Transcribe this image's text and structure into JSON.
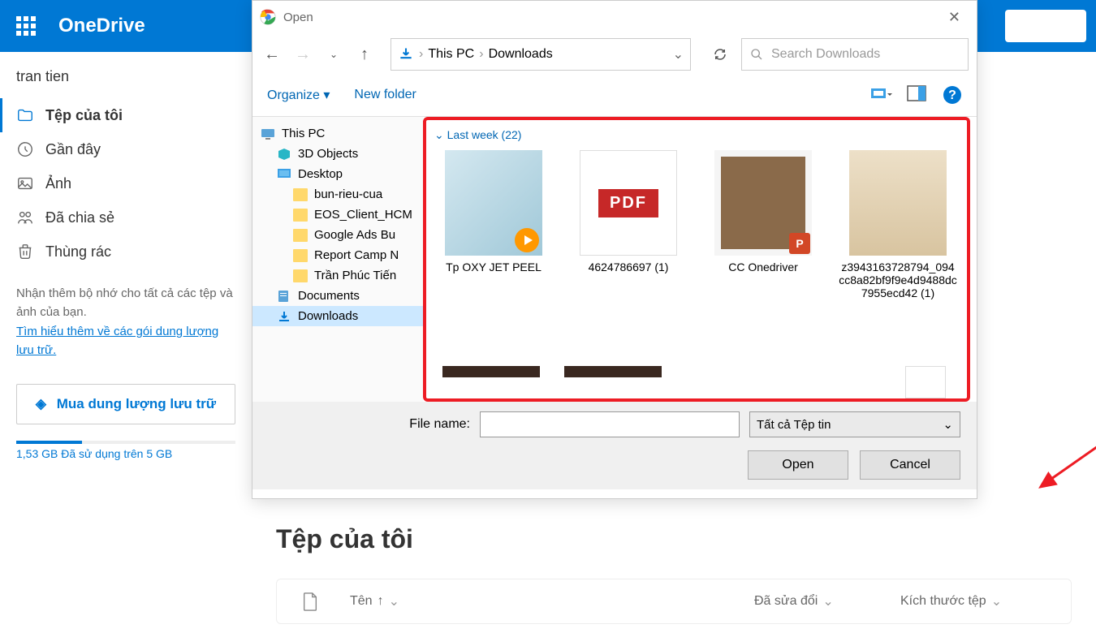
{
  "onedrive": {
    "app_name": "OneDrive",
    "user_name": "tran tien",
    "nav": [
      {
        "icon": "folder",
        "label": "Tệp của tôi",
        "active": true
      },
      {
        "icon": "recent",
        "label": "Gần đây",
        "active": false
      },
      {
        "icon": "photos",
        "label": "Ảnh",
        "active": false
      },
      {
        "icon": "shared",
        "label": "Đã chia sẻ",
        "active": false
      },
      {
        "icon": "trash",
        "label": "Thùng rác",
        "active": false
      }
    ],
    "storage_promo_line1": "Nhận thêm bộ nhớ cho tất cả các tệp và ảnh của bạn.",
    "storage_link": "Tìm hiểu thêm về các gói dung lượng lưu trữ.",
    "premium_button": "Mua dung lượng lưu trữ",
    "storage_used_text": "1,53 GB Đã sử dụng trên 5 GB",
    "content_title": "Tệp của tôi",
    "columns": {
      "name": "Tên",
      "modified": "Đã sửa đổi",
      "size": "Kích thước tệp"
    }
  },
  "dialog": {
    "title": "Open",
    "breadcrumb": [
      "This PC",
      "Downloads"
    ],
    "search_placeholder": "Search Downloads",
    "toolbar": {
      "organize": "Organize",
      "new_folder": "New folder"
    },
    "tree": [
      {
        "icon": "pc",
        "label": "This PC",
        "indent": 0
      },
      {
        "icon": "3d",
        "label": "3D Objects",
        "indent": 1
      },
      {
        "icon": "desktop",
        "label": "Desktop",
        "indent": 1
      },
      {
        "icon": "folder",
        "label": "bun-rieu-cua",
        "indent": 2
      },
      {
        "icon": "folder",
        "label": "EOS_Client_HCM",
        "indent": 2
      },
      {
        "icon": "folder",
        "label": "Google Ads Bu",
        "indent": 2
      },
      {
        "icon": "folder",
        "label": "Report Camp N",
        "indent": 2
      },
      {
        "icon": "folder",
        "label": "Trần Phúc Tiến",
        "indent": 2
      },
      {
        "icon": "docs",
        "label": "Documents",
        "indent": 1
      },
      {
        "icon": "downloads",
        "label": "Downloads",
        "indent": 1,
        "selected": true
      }
    ],
    "group_header": "Last week (22)",
    "files": [
      {
        "name": "Tp OXY JET PEEL",
        "type": "video"
      },
      {
        "name": "4624786697 (1)",
        "type": "pdf"
      },
      {
        "name": "CC Onedriver",
        "type": "pptx"
      },
      {
        "name": "z3943163728794_094cc8a82bf9f9e4d9488dc7955ecd42 (1)",
        "type": "image"
      }
    ],
    "filename_label": "File name:",
    "filename_value": "",
    "filetype": "Tất cả Tệp tin",
    "open_button": "Open",
    "cancel_button": "Cancel"
  }
}
